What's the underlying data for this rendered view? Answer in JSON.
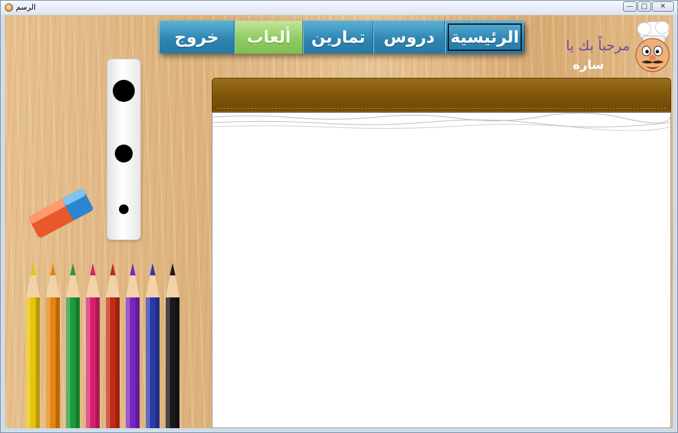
{
  "window": {
    "title": "الرسم",
    "minimize_label": "—",
    "maximize_label": "□",
    "close_label": "✕"
  },
  "nav": {
    "home": "الرئيسية",
    "lessons": "دروس",
    "exercises": "تمارين",
    "games": "ألعاب",
    "exit": "خروج",
    "active": "games",
    "focused": "home"
  },
  "greeting": {
    "welcome": "مرحباً بك يا",
    "username": "ساره"
  },
  "brush_sizes": [
    "large",
    "medium",
    "small"
  ],
  "pencil_colors": [
    {
      "name": "yellow",
      "color": "#e8c20a"
    },
    {
      "name": "orange",
      "color": "#e6840c"
    },
    {
      "name": "green",
      "color": "#1e9a3a"
    },
    {
      "name": "pink",
      "color": "#d6206b"
    },
    {
      "name": "red",
      "color": "#c22a14"
    },
    {
      "name": "purple",
      "color": "#7a24c0"
    },
    {
      "name": "blue",
      "color": "#2a3aa8"
    },
    {
      "name": "black",
      "color": "#1a1a1a"
    }
  ],
  "colors": {
    "nav_blue": "#2e86b2",
    "nav_active_green": "#8fcb62",
    "canvas_header_brown": "#7b5208"
  }
}
